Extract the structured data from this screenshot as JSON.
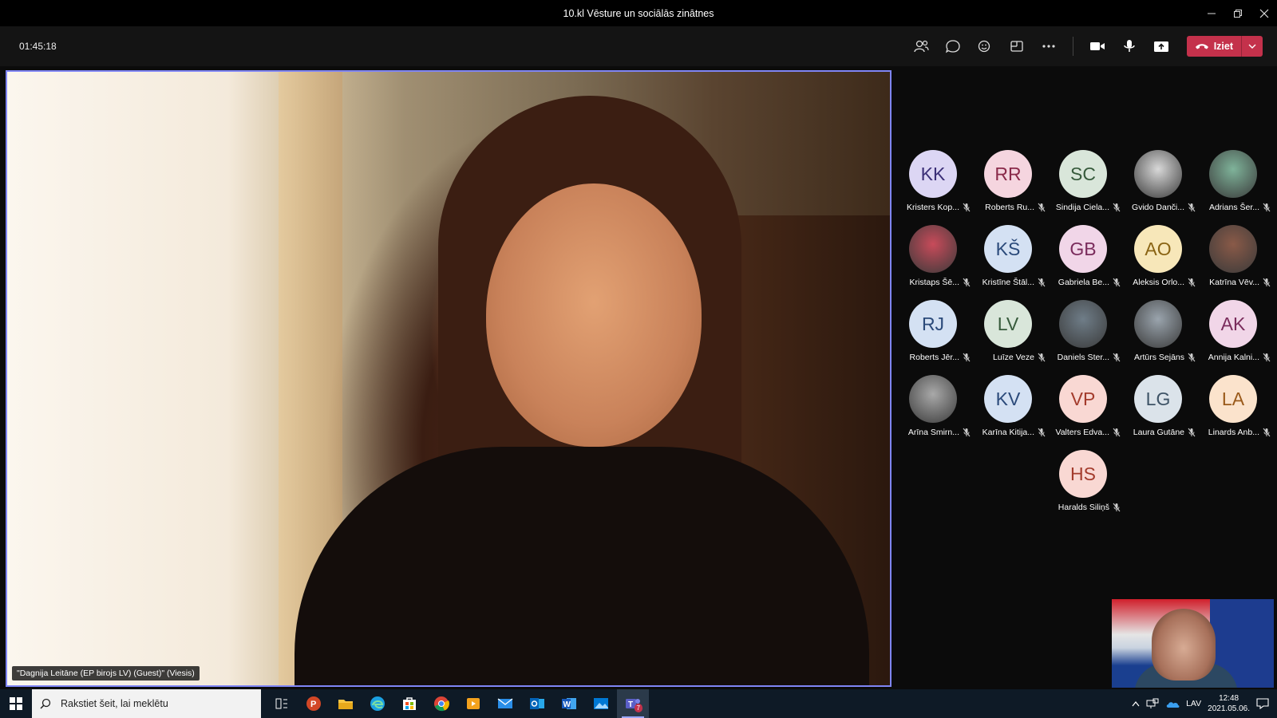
{
  "window": {
    "title": "10.kl Vēsture un sociālās zinātnes"
  },
  "toolbar": {
    "timer": "01:45:18",
    "leave_label": "Iziet"
  },
  "main_video": {
    "name_tag": "\"Dagnija Leitāne (EP birojs LV) (Guest)\" (Viesis)"
  },
  "participants": [
    {
      "initials": "KK",
      "name": "Kristers Kop...",
      "bg": "#dcd6f4",
      "fg": "#3b2f77",
      "photo": false
    },
    {
      "initials": "RR",
      "name": "Roberts Ru...",
      "bg": "#f5d5df",
      "fg": "#8a2a4a",
      "photo": false
    },
    {
      "initials": "SC",
      "name": "Sindija Ciela...",
      "bg": "#d9e6da",
      "fg": "#365a3b",
      "photo": false
    },
    {
      "initials": "",
      "name": "Gvido Danči...",
      "bg": "#d8d8d8",
      "fg": "#333",
      "photo": true
    },
    {
      "initials": "",
      "name": "Adrians Šer...",
      "bg": "#7fb39a",
      "fg": "#333",
      "photo": true
    },
    {
      "initials": "",
      "name": "Kristaps Šē...",
      "bg": "#c84b5a",
      "fg": "#333",
      "photo": true
    },
    {
      "initials": "KŠ",
      "name": "Kristīne Štāl...",
      "bg": "#d4e1f3",
      "fg": "#2b4a7a",
      "photo": false
    },
    {
      "initials": "GB",
      "name": "Gabriela Be...",
      "bg": "#f1d6e8",
      "fg": "#7a2c5c",
      "photo": false
    },
    {
      "initials": "AO",
      "name": "Aleksis Orlo...",
      "bg": "#f7e7b9",
      "fg": "#8a6414",
      "photo": false
    },
    {
      "initials": "",
      "name": "Katrīna Vēv...",
      "bg": "#8a5a48",
      "fg": "#333",
      "photo": true
    },
    {
      "initials": "RJ",
      "name": "Roberts Jēr...",
      "bg": "#d4e1f3",
      "fg": "#2b4a7a",
      "photo": false
    },
    {
      "initials": "LV",
      "name": "Luīze Veze",
      "bg": "#d9e6da",
      "fg": "#365a3b",
      "photo": false
    },
    {
      "initials": "",
      "name": "Daniels Ster...",
      "bg": "#6f7d88",
      "fg": "#333",
      "photo": true
    },
    {
      "initials": "",
      "name": "Artūrs Sejāns",
      "bg": "#9aa4ad",
      "fg": "#333",
      "photo": true
    },
    {
      "initials": "AK",
      "name": "Annija Kalni...",
      "bg": "#f1d6e8",
      "fg": "#7a2c5c",
      "photo": false
    },
    {
      "initials": "",
      "name": "Arīna Smirn...",
      "bg": "#a9a9a9",
      "fg": "#333",
      "photo": true
    },
    {
      "initials": "KV",
      "name": "Karīna Kitija...",
      "bg": "#d4e1f3",
      "fg": "#2b4a7a",
      "photo": false
    },
    {
      "initials": "VP",
      "name": "Valters Edva...",
      "bg": "#f9d8d3",
      "fg": "#a33b2c",
      "photo": false
    },
    {
      "initials": "LG",
      "name": "Laura Gutāne",
      "bg": "#dbe3ea",
      "fg": "#3e5366",
      "photo": false
    },
    {
      "initials": "LA",
      "name": "Linards Anb...",
      "bg": "#fbe3cc",
      "fg": "#9a5a1a",
      "photo": false
    },
    {
      "initials": "HS",
      "name": "Haralds Siliņš",
      "bg": "#f9d8d3",
      "fg": "#a33b2c",
      "photo": false
    }
  ],
  "taskbar": {
    "search_placeholder": "Rakstiet šeit, lai meklētu",
    "language": "LAV",
    "time": "12:48",
    "date": "2021.05.06.",
    "teams_badge": "7"
  }
}
